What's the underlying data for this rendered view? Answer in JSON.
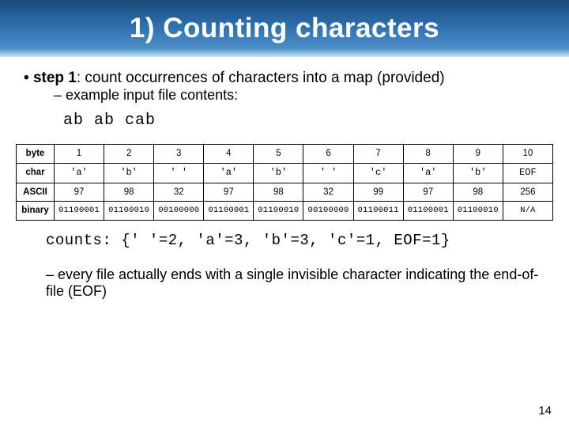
{
  "title": "1) Counting characters",
  "bullet1_bold": "step 1",
  "bullet1_rest": ": count occurrences of characters into a map (provided)",
  "bullet1_sub": "example input file contents:",
  "example_code": "ab ab cab",
  "table": {
    "row_labels": [
      "byte",
      "char",
      "ASCII",
      "binary"
    ],
    "byte": [
      "1",
      "2",
      "3",
      "4",
      "5",
      "6",
      "7",
      "8",
      "9",
      "10"
    ],
    "char": [
      "'a'",
      "'b'",
      "' '",
      "'a'",
      "'b'",
      "' '",
      "'c'",
      "'a'",
      "'b'",
      "EOF"
    ],
    "ascii": [
      "97",
      "98",
      "32",
      "97",
      "98",
      "32",
      "99",
      "97",
      "98",
      "256"
    ],
    "binary": [
      "01100001",
      "01100010",
      "00100000",
      "01100001",
      "01100010",
      "00100000",
      "01100011",
      "01100001",
      "01100010",
      "N/A"
    ]
  },
  "counts_line": "counts: {' '=2, 'a'=3, 'b'=3, 'c'=1, EOF=1}",
  "bullet2": "every file actually ends with a single invisible character indicating the end-of-file (EOF)",
  "slide_number": "14"
}
